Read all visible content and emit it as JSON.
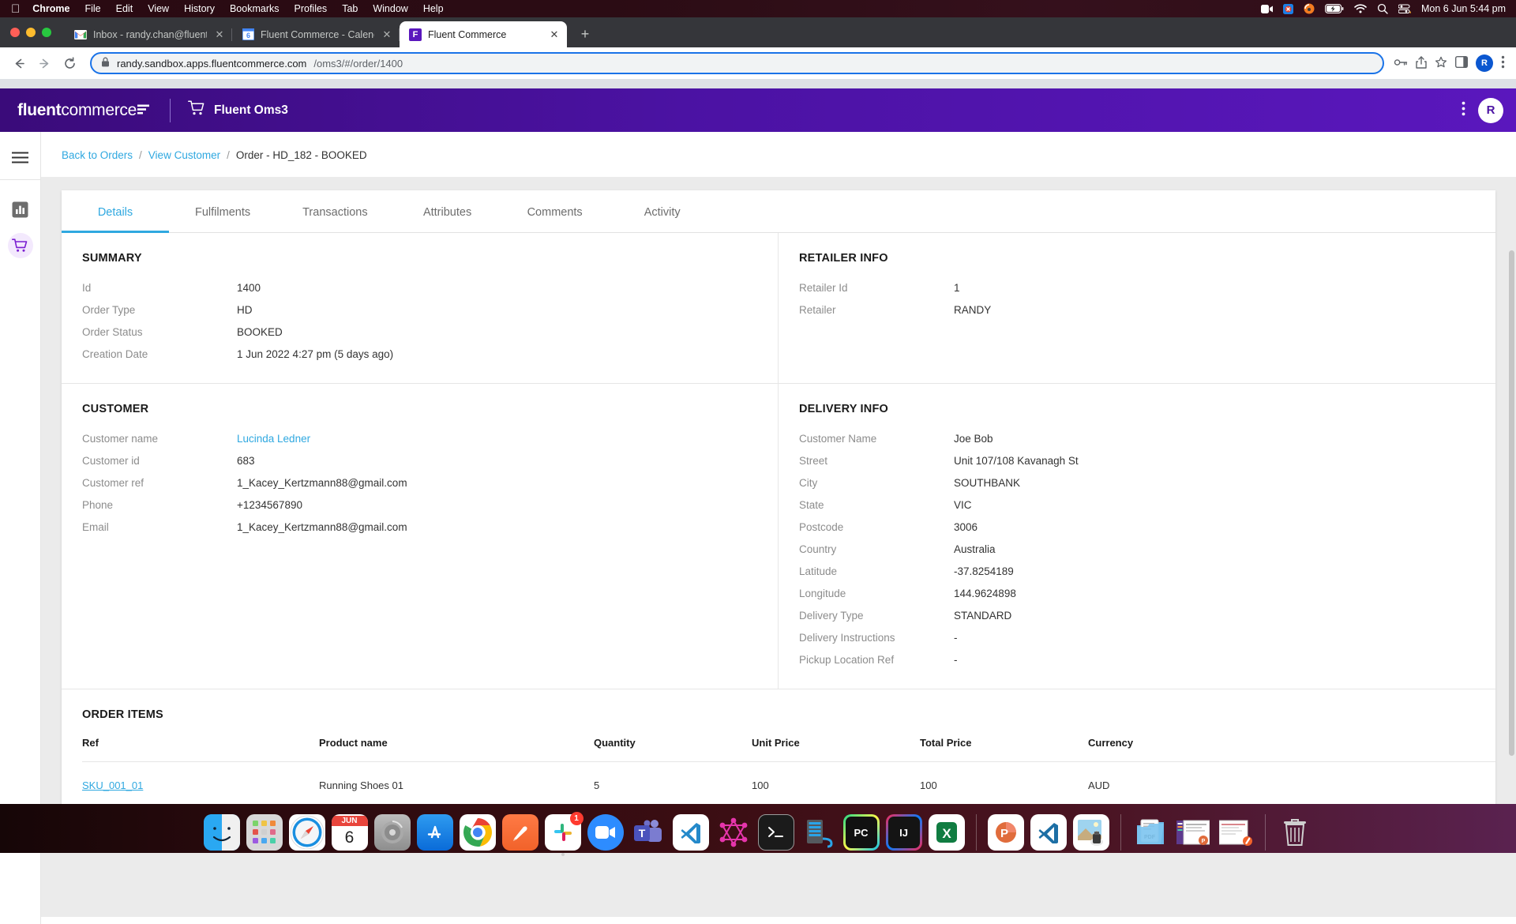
{
  "os": {
    "menubar": {
      "apple_icon": "apple-icon",
      "items": [
        "Chrome",
        "File",
        "Edit",
        "View",
        "History",
        "Bookmarks",
        "Profiles",
        "Tab",
        "Window",
        "Help"
      ],
      "status_icons": [
        "video-icon",
        "firewall-icon",
        "vpn-icon",
        "battery-icon",
        "wifi-icon",
        "search-icon",
        "control-center-icon"
      ],
      "clock": "Mon 6 Jun  5:44 pm"
    },
    "dock": {
      "items": [
        {
          "name": "finder",
          "label": "Finder",
          "running": true
        },
        {
          "name": "launchpad",
          "label": "Launchpad",
          "running": false
        },
        {
          "name": "safari",
          "label": "Safari",
          "running": true
        },
        {
          "name": "calendar",
          "label": "Calendar",
          "month": "JUN",
          "day": "6",
          "running": false
        },
        {
          "name": "system-preferences",
          "label": "System Preferences",
          "running": false
        },
        {
          "name": "app-store",
          "label": "App Store",
          "running": false
        },
        {
          "name": "google-chrome",
          "label": "Google Chrome",
          "running": true
        },
        {
          "name": "postman",
          "label": "Postman",
          "running": true
        },
        {
          "name": "slack",
          "label": "Slack",
          "badge": "1",
          "running": true
        },
        {
          "name": "zoom",
          "label": "Zoom",
          "running": true
        },
        {
          "name": "microsoft-teams",
          "label": "Microsoft Teams",
          "running": false
        },
        {
          "name": "visual-studio-code",
          "label": "Visual Studio Code",
          "running": true
        },
        {
          "name": "graphql-playground",
          "label": "GraphQL",
          "running": false
        },
        {
          "name": "terminal",
          "label": "Terminal",
          "running": false
        },
        {
          "name": "server",
          "label": "Server",
          "running": false
        },
        {
          "name": "pycharm",
          "label": "PyCharm",
          "running": false
        },
        {
          "name": "intellij-idea",
          "label": "IntelliJ IDEA",
          "running": false
        },
        {
          "name": "excel",
          "label": "Microsoft Excel",
          "running": false
        },
        {
          "name": "powerpoint",
          "label": "Microsoft PowerPoint",
          "running": true
        },
        {
          "name": "vscode-insiders",
          "label": "VS Code Insiders",
          "running": false
        },
        {
          "name": "preview",
          "label": "Preview",
          "running": false
        },
        {
          "name": "downloads-stack",
          "label": "Downloads",
          "running": false
        },
        {
          "name": "window-stack-1",
          "label": "Window",
          "running": false
        },
        {
          "name": "window-stack-2",
          "label": "Window",
          "running": false
        },
        {
          "name": "trash",
          "label": "Trash",
          "running": false
        }
      ]
    }
  },
  "browser": {
    "tabs": [
      {
        "title": "Inbox - randy.chan@fluentcom",
        "favicon": "gmail-icon",
        "active": false
      },
      {
        "title": "Fluent Commerce - Calendar -",
        "favicon": "google-calendar-icon",
        "active": false
      },
      {
        "title": "Fluent Commerce",
        "favicon": "fluent-icon",
        "active": true
      }
    ],
    "new_tab_label": "+",
    "nav": {
      "back": "back-icon",
      "forward": "forward-icon",
      "reload": "reload-icon"
    },
    "omnibox": {
      "lock": "lock-icon",
      "url_host": "randy.sandbox.apps.fluentcommerce.com",
      "url_path": "/oms3/#/order/1400"
    },
    "toolbar_right": [
      "password-key-icon",
      "share-icon",
      "bookmark-star-icon",
      "side-panel-icon"
    ],
    "profile_initial": "R",
    "menu_icon": "kebab-menu-icon"
  },
  "app": {
    "logo": {
      "bold": "fluent",
      "light": "commerce",
      "mark": "fluent-logo-mark"
    },
    "title": "Fluent Oms3",
    "title_icon": "shopping-cart-icon",
    "header_menu_icon": "kebab-menu-icon",
    "avatar_initial": "R",
    "accent_color": "#2fa8e0",
    "brand_color": "#4b12a3",
    "rail": [
      {
        "name": "hamburger-menu",
        "icon": "hamburger-icon",
        "active": false
      },
      {
        "name": "reports",
        "icon": "bar-chart-icon",
        "active": false
      },
      {
        "name": "orders",
        "icon": "shopping-cart-icon",
        "active": true
      }
    ],
    "breadcrumb": {
      "back_to_orders": "Back to Orders",
      "view_customer": "View Customer",
      "separator": "/",
      "current": "Order - HD_182 - BOOKED"
    },
    "tabs": [
      {
        "label": "Details",
        "active": true
      },
      {
        "label": "Fulfilments",
        "active": false
      },
      {
        "label": "Transactions",
        "active": false
      },
      {
        "label": "Attributes",
        "active": false
      },
      {
        "label": "Comments",
        "active": false
      },
      {
        "label": "Activity",
        "active": false
      }
    ],
    "summary": {
      "title": "SUMMARY",
      "rows": [
        {
          "label": "Id",
          "value": "1400"
        },
        {
          "label": "Order Type",
          "value": "HD"
        },
        {
          "label": "Order Status",
          "value": "BOOKED"
        },
        {
          "label": "Creation Date",
          "value": "1 Jun 2022 4:27 pm (5 days ago)"
        }
      ]
    },
    "retailer_info": {
      "title": "RETAILER INFO",
      "rows": [
        {
          "label": "Retailer Id",
          "value": "1"
        },
        {
          "label": "Retailer",
          "value": "RANDY"
        }
      ]
    },
    "customer": {
      "title": "CUSTOMER",
      "rows": [
        {
          "label": "Customer name",
          "value": "Lucinda Ledner",
          "link": true
        },
        {
          "label": "Customer id",
          "value": "683"
        },
        {
          "label": "Customer ref",
          "value": "1_Kacey_Kertzmann88@gmail.com"
        },
        {
          "label": "Phone",
          "value": "+1234567890"
        },
        {
          "label": "Email",
          "value": "1_Kacey_Kertzmann88@gmail.com"
        }
      ]
    },
    "delivery_info": {
      "title": "DELIVERY INFO",
      "rows": [
        {
          "label": "Customer Name",
          "value": "Joe Bob"
        },
        {
          "label": "Street",
          "value": "Unit 107/108 Kavanagh St"
        },
        {
          "label": "City",
          "value": "SOUTHBANK"
        },
        {
          "label": "State",
          "value": "VIC"
        },
        {
          "label": "Postcode",
          "value": "3006"
        },
        {
          "label": "Country",
          "value": "Australia"
        },
        {
          "label": "Latitude",
          "value": "-37.8254189"
        },
        {
          "label": "Longitude",
          "value": "144.9624898"
        },
        {
          "label": "Delivery Type",
          "value": "STANDARD"
        },
        {
          "label": "Delivery Instructions",
          "value": "-"
        },
        {
          "label": "Pickup Location Ref",
          "value": "-"
        }
      ]
    },
    "order_items": {
      "title": "ORDER ITEMS",
      "columns": [
        "Ref",
        "Product name",
        "Quantity",
        "Unit Price",
        "Total Price",
        "Currency"
      ],
      "rows": [
        {
          "ref": "SKU_001_01",
          "product_name": "Running Shoes 01",
          "quantity": "5",
          "unit_price": "100",
          "total_price": "100",
          "currency": "AUD"
        }
      ]
    }
  }
}
